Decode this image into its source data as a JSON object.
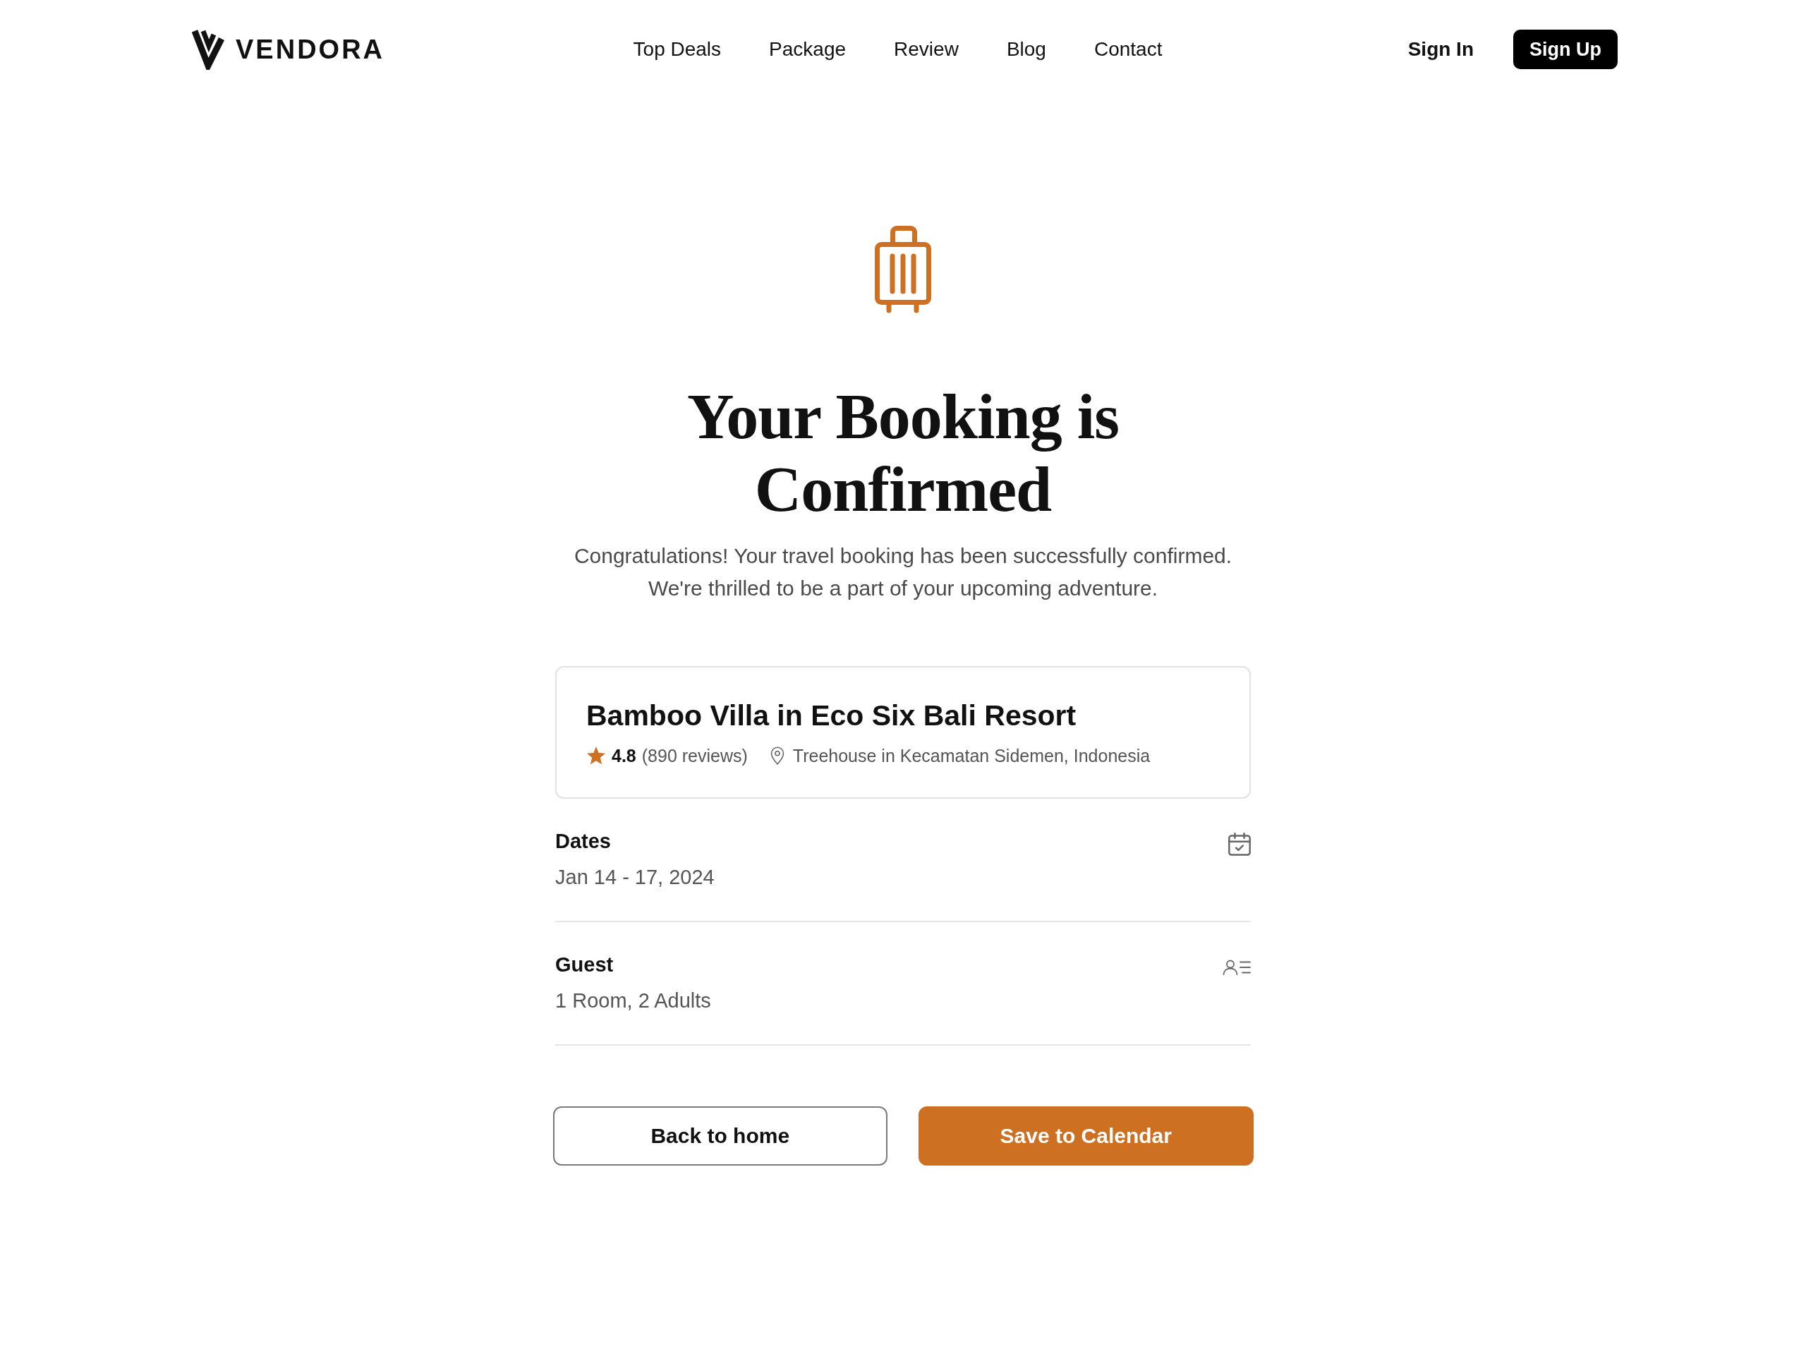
{
  "header": {
    "logo": {
      "text": "VENDORA"
    },
    "nav": [
      {
        "label": "Top Deals"
      },
      {
        "label": "Package"
      },
      {
        "label": "Review"
      },
      {
        "label": "Blog"
      },
      {
        "label": "Contact"
      }
    ],
    "sign_in": "Sign In",
    "sign_up": "Sign Up"
  },
  "confirmation": {
    "title": "Your Booking is Confirmed",
    "message": "Congratulations! Your travel booking has been successfully confirmed. We're thrilled to be a part of your upcoming adventure."
  },
  "listing": {
    "name": "Bamboo Villa in Eco Six Bali Resort",
    "rating": "4.8",
    "reviews": "(890 reviews)",
    "location": "Treehouse in Kecamatan Sidemen, Indonesia"
  },
  "details": [
    {
      "kind": "calendar",
      "label": "Dates",
      "value": "Jan 14 - 17, 2024"
    },
    {
      "kind": "guest",
      "label": "Guest",
      "value": "1 Room, 2 Adults"
    }
  ],
  "actions": [
    {
      "kind": "outline",
      "label": "Back to home"
    },
    {
      "kind": "filled",
      "label": "Save to Calendar"
    }
  ]
}
